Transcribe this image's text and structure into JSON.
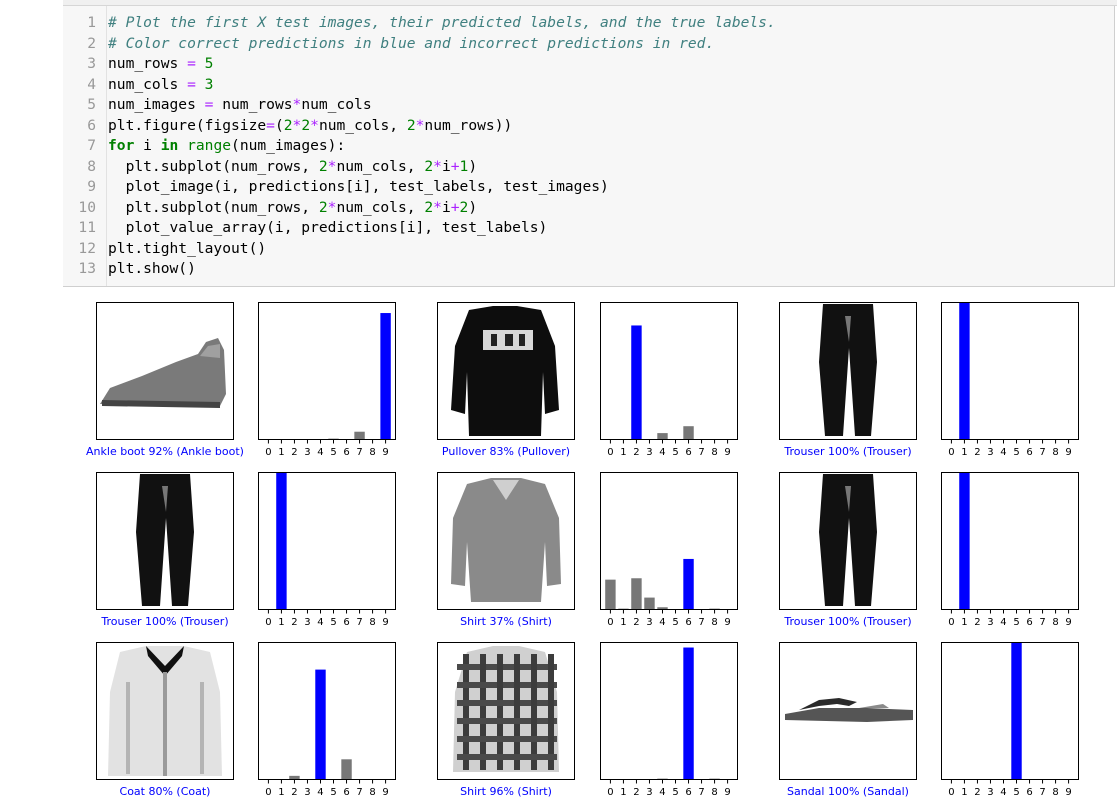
{
  "code": {
    "lines": [
      "# Plot the first X test images, their predicted labels, and the true labels.",
      "# Color correct predictions in blue and incorrect predictions in red.",
      "num_rows = 5",
      "num_cols = 3",
      "num_images = num_rows*num_cols",
      "plt.figure(figsize=(2*2*num_cols, 2*num_rows))",
      "for i in range(num_images):",
      "  plt.subplot(num_rows, 2*num_cols, 2*i+1)",
      "  plot_image(i, predictions[i], test_labels, test_images)",
      "  plt.subplot(num_rows, 2*num_cols, 2*i+2)",
      "  plot_value_array(i, predictions[i], test_labels)",
      "plt.tight_layout()",
      "plt.show()"
    ],
    "line_numbers": [
      "1",
      "2",
      "3",
      "4",
      "5",
      "6",
      "7",
      "8",
      "9",
      "10",
      "11",
      "12",
      "13"
    ]
  },
  "colors": {
    "correct": "#0000ff",
    "incorrect": "#ff0000",
    "other_bar": "#777777"
  },
  "chart_data": [
    {
      "type": "image",
      "label": "Ankle boot 92% (Ankle boot)",
      "image": "ankle-boot"
    },
    {
      "type": "bar",
      "categories": [
        0,
        1,
        2,
        3,
        4,
        5,
        6,
        7,
        8,
        9
      ],
      "values": [
        0,
        0,
        0,
        0,
        0,
        0.01,
        0,
        0.06,
        0,
        0.92
      ],
      "highlight": 9,
      "ylim": [
        0,
        1
      ]
    },
    {
      "type": "image",
      "label": "Pullover 83% (Pullover)",
      "image": "pullover"
    },
    {
      "type": "bar",
      "categories": [
        0,
        1,
        2,
        3,
        4,
        5,
        6,
        7,
        8,
        9
      ],
      "values": [
        0,
        0,
        0.83,
        0,
        0.05,
        0,
        0.1,
        0,
        0,
        0
      ],
      "highlight": 2,
      "ylim": [
        0,
        1
      ]
    },
    {
      "type": "image",
      "label": "Trouser 100% (Trouser)",
      "image": "trouser"
    },
    {
      "type": "bar",
      "categories": [
        0,
        1,
        2,
        3,
        4,
        5,
        6,
        7,
        8,
        9
      ],
      "values": [
        0,
        1.0,
        0,
        0,
        0,
        0,
        0,
        0,
        0,
        0
      ],
      "highlight": 1,
      "ylim": [
        0,
        1
      ]
    },
    {
      "type": "image",
      "label": "Trouser 100% (Trouser)",
      "image": "trouser"
    },
    {
      "type": "bar",
      "categories": [
        0,
        1,
        2,
        3,
        4,
        5,
        6,
        7,
        8,
        9
      ],
      "values": [
        0,
        1.0,
        0,
        0,
        0,
        0,
        0,
        0,
        0,
        0
      ],
      "highlight": 1,
      "ylim": [
        0,
        1
      ]
    },
    {
      "type": "image",
      "label": "Shirt 37% (Shirt)",
      "image": "shirt"
    },
    {
      "type": "bar",
      "categories": [
        0,
        1,
        2,
        3,
        4,
        5,
        6,
        7,
        8,
        9
      ],
      "values": [
        0.22,
        0.01,
        0.23,
        0.09,
        0.02,
        0,
        0.37,
        0,
        0.01,
        0
      ],
      "highlight": 6,
      "ylim": [
        0,
        1
      ]
    },
    {
      "type": "image",
      "label": "Trouser 100% (Trouser)",
      "image": "trouser"
    },
    {
      "type": "bar",
      "categories": [
        0,
        1,
        2,
        3,
        4,
        5,
        6,
        7,
        8,
        9
      ],
      "values": [
        0,
        1.0,
        0,
        0,
        0,
        0,
        0,
        0,
        0,
        0
      ],
      "highlight": 1,
      "ylim": [
        0,
        1
      ]
    },
    {
      "type": "image",
      "label": "Coat 80% (Coat)",
      "image": "coat"
    },
    {
      "type": "bar",
      "categories": [
        0,
        1,
        2,
        3,
        4,
        5,
        6,
        7,
        8,
        9
      ],
      "values": [
        0,
        0,
        0.03,
        0,
        0.8,
        0,
        0.15,
        0,
        0,
        0
      ],
      "highlight": 4,
      "ylim": [
        0,
        1
      ]
    },
    {
      "type": "image",
      "label": "Shirt 96% (Shirt)",
      "image": "plaid-shirt"
    },
    {
      "type": "bar",
      "categories": [
        0,
        1,
        2,
        3,
        4,
        5,
        6,
        7,
        8,
        9
      ],
      "values": [
        0,
        0,
        0,
        0,
        0.01,
        0,
        0.96,
        0,
        0.01,
        0
      ],
      "highlight": 6,
      "ylim": [
        0,
        1
      ]
    },
    {
      "type": "image",
      "label": "Sandal 100% (Sandal)",
      "image": "sandal"
    },
    {
      "type": "bar",
      "categories": [
        0,
        1,
        2,
        3,
        4,
        5,
        6,
        7,
        8,
        9
      ],
      "values": [
        0,
        0,
        0,
        0,
        0,
        1.0,
        0,
        0,
        0,
        0
      ],
      "highlight": 5,
      "ylim": [
        0,
        1
      ]
    }
  ]
}
